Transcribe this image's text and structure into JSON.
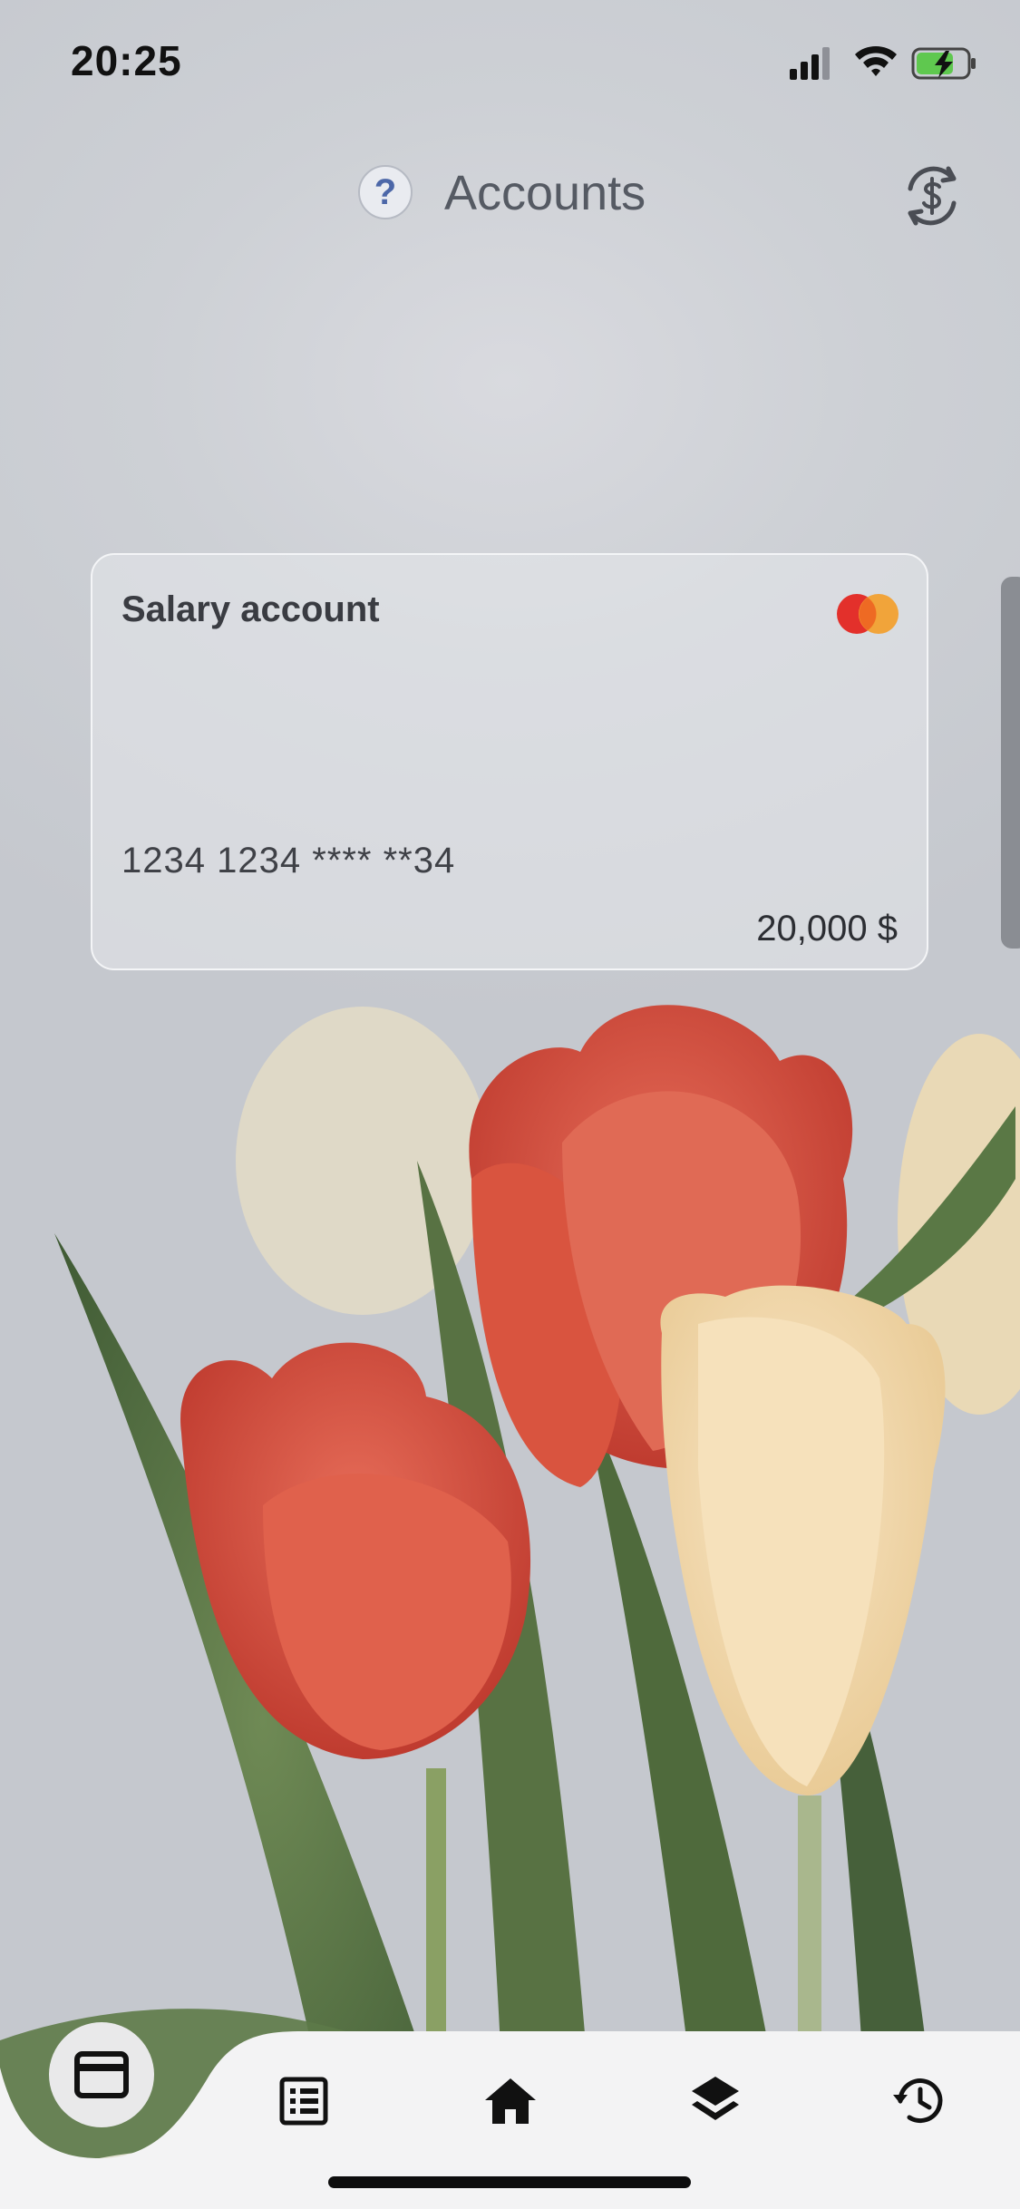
{
  "status_bar": {
    "time": "20:25"
  },
  "header": {
    "help_symbol": "?",
    "title": "Accounts"
  },
  "account_card": {
    "name": "Salary account",
    "number": "1234 1234 **** **34",
    "balance": "20,000 $",
    "network": "mastercard-logo"
  },
  "tab_bar": {
    "tabs": [
      {
        "icon": "credit-card-icon",
        "selected": true
      },
      {
        "icon": "list-icon",
        "selected": false
      },
      {
        "icon": "home-icon",
        "selected": false
      },
      {
        "icon": "layers-icon",
        "selected": false
      },
      {
        "icon": "history-icon",
        "selected": false
      }
    ]
  },
  "colors": {
    "accent_blue": "#4c67a8",
    "mastercard_red": "#e3302b",
    "mastercard_orange": "#f2a030"
  }
}
